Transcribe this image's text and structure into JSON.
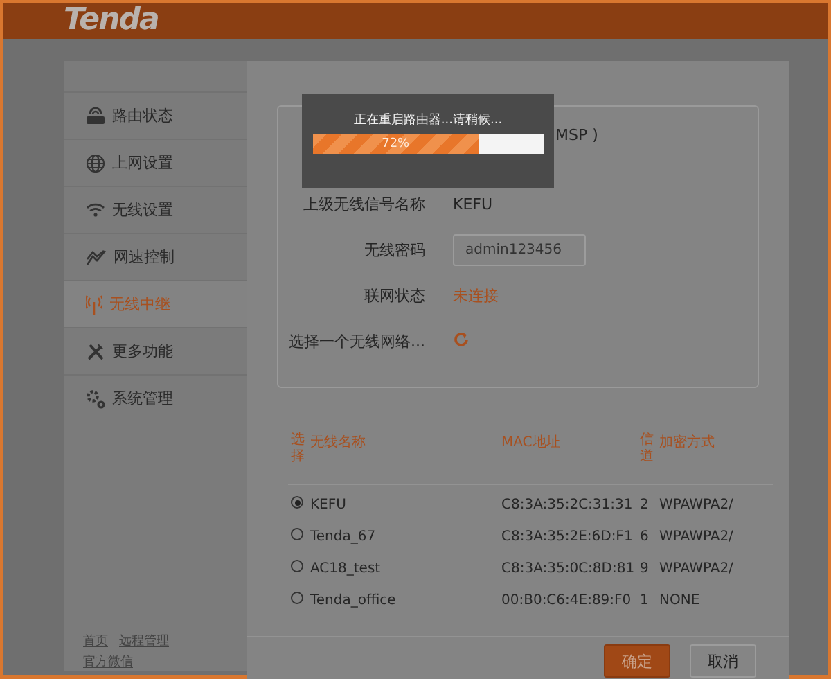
{
  "header": {
    "logo": "Tenda"
  },
  "sidebar": {
    "items": [
      {
        "label": "路由状态",
        "selected": false
      },
      {
        "label": "上网设置",
        "selected": false
      },
      {
        "label": "无线设置",
        "selected": false
      },
      {
        "label": "网速控制",
        "selected": false
      },
      {
        "label": "无线中继",
        "selected": true
      },
      {
        "label": "更多功能",
        "selected": false
      },
      {
        "label": "系统管理",
        "selected": false
      }
    ],
    "footer_links": [
      "首页",
      "远程管理",
      "官方微信"
    ]
  },
  "form": {
    "partial_value": "MSP )",
    "fields": [
      {
        "kind": "text",
        "label": "上级无线信号名称",
        "value": "KEFU"
      },
      {
        "kind": "input",
        "label": "无线密码",
        "value": "admin123456"
      },
      {
        "kind": "status",
        "label": "联网状态",
        "value": "未连接"
      },
      {
        "kind": "refresh",
        "label": "选择一个无线网络..."
      }
    ]
  },
  "table": {
    "columns": [
      "选择",
      "无线名称",
      "MAC地址",
      "信道",
      "加密方式"
    ],
    "rows": [
      {
        "selected": true,
        "name": "KEFU",
        "mac": "C8:3A:35:2C:31:31",
        "channel": "2",
        "security": "WPAWPA2/"
      },
      {
        "selected": false,
        "name": "Tenda_67",
        "mac": "C8:3A:35:2E:6D:F1",
        "channel": "6",
        "security": "WPAWPA2/"
      },
      {
        "selected": false,
        "name": "AC18_test",
        "mac": "C8:3A:35:0C:8D:81",
        "channel": "9",
        "security": "WPAWPA2/"
      },
      {
        "selected": false,
        "name": "Tenda_office",
        "mac": "00:B0:C6:4E:89:F0",
        "channel": "1",
        "security": "NONE"
      }
    ]
  },
  "buttons": [
    {
      "kind": "primary",
      "label": "确定"
    },
    {
      "kind": "secondary",
      "label": "取消"
    }
  ],
  "dialog": {
    "message": "正在重启路由器...请稍候...",
    "progress": {
      "level": 0.72,
      "reading": "72%"
    }
  }
}
